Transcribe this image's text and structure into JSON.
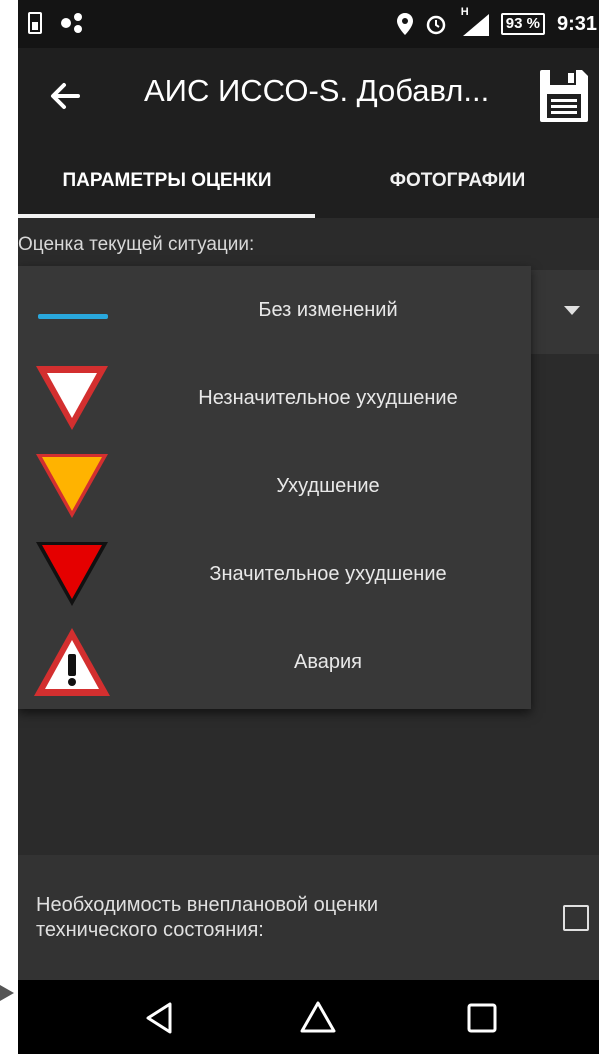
{
  "status_bar": {
    "time": "9:31",
    "battery": "93 %",
    "network_label": "H",
    "icons": [
      "sim-icon",
      "sync-icon",
      "location-icon",
      "alarm-icon",
      "signal-icon",
      "battery-icon"
    ]
  },
  "app_bar": {
    "title": "АИС ИССО-S. Добавл...",
    "back_icon": "arrow-left-icon",
    "save_icon": "floppy-disk-icon"
  },
  "tabs": [
    {
      "label": "ПАРАМЕТРЫ ОЦЕНКИ",
      "active": true
    },
    {
      "label": "ФОТОГРАФИИ",
      "active": false
    }
  ],
  "evaluation": {
    "label": "Оценка текущей ситуации:"
  },
  "dropdown": {
    "options": [
      {
        "label": "Без изменений",
        "icon": "blue-line-icon",
        "color": "#29a8dd"
      },
      {
        "label": "Незначительное ухудшение",
        "icon": "white-triangle-icon",
        "color": "#ffffff"
      },
      {
        "label": "Ухудшение",
        "icon": "orange-triangle-icon",
        "color": "#ffb300"
      },
      {
        "label": "Значительное ухудшение",
        "icon": "red-triangle-icon",
        "color": "#e50000"
      },
      {
        "label": "Авария",
        "icon": "warning-triangle-icon",
        "color": "#d32f2f"
      }
    ]
  },
  "unplanned": {
    "label": "Необходимость внеплановой оценки технического состояния:",
    "checked": false
  },
  "colors": {
    "background": "#2b2b2b",
    "app_bar": "#1f1f1f",
    "status_bar": "#141414",
    "accent_blue": "#29a8dd"
  }
}
